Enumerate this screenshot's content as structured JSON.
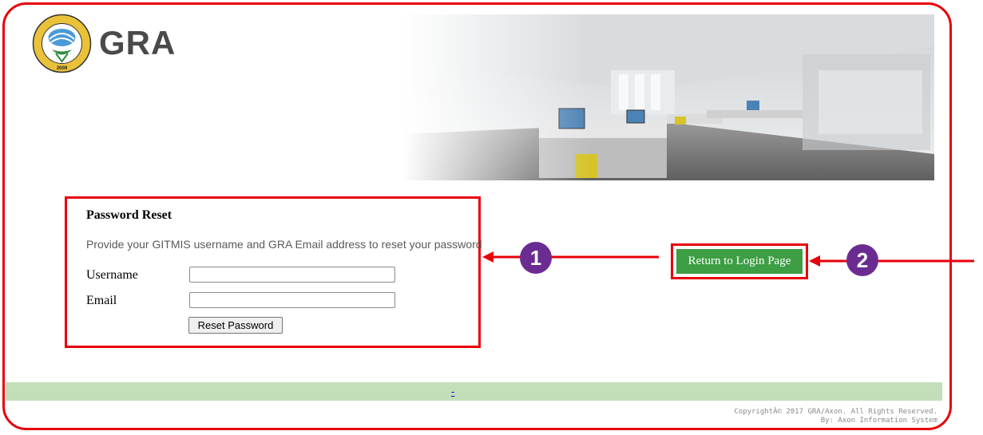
{
  "header": {
    "brand_text": "GRA",
    "logo_ring_text": "GHANA REVENUE AUTHORITY",
    "logo_year": "2009"
  },
  "reset_form": {
    "title": "Password Reset",
    "description": "Provide your GITMIS username and GRA Email address to reset your password",
    "username_label": "Username",
    "username_value": "",
    "email_label": "Email",
    "email_value": "",
    "submit_label": "Reset Password"
  },
  "login_link": {
    "label": "Return to Login Page"
  },
  "annotations": {
    "badge_1": "1",
    "badge_2": "2",
    "highlight_color": "#e8000b",
    "badge_color": "#6b2c91"
  },
  "footer": {
    "link_text": "-",
    "copyright_line1": "CopyrightÂ© 2017 GRA/Axon. All Rights Reserved.",
    "copyright_line2": "By: Axon Information System"
  },
  "colors": {
    "button_green": "#3d9e43",
    "footer_green": "#c2dfba"
  }
}
